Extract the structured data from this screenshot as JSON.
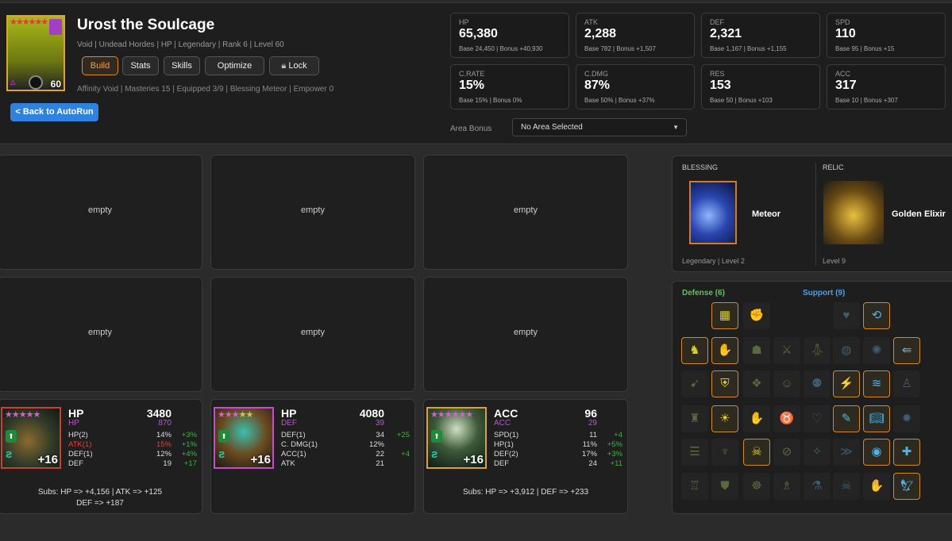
{
  "hero": {
    "name": "Urost the Soulcage",
    "meta": "Void | Undead Hordes | HP | Legendary | Rank 6 | Level 60",
    "meta2": "Affinity Void  |  Masteries 15  |  Equipped 3/9  |  Blessing Meteor  |  Empower 0",
    "level": "60",
    "stars": "★★★★★★"
  },
  "tabs": [
    "Build",
    "Stats",
    "Skills",
    "Optimize"
  ],
  "lock_label": "Lock",
  "back_label": "< Back to AutoRun",
  "stats": [
    {
      "label": "HP",
      "value": "65,380",
      "sub": "Base 24,450  |  Bonus +40,930"
    },
    {
      "label": "ATK",
      "value": "2,288",
      "sub": "Base 782  |  Bonus +1,507"
    },
    {
      "label": "DEF",
      "value": "2,321",
      "sub": "Base 1,167  |  Bonus +1,155"
    },
    {
      "label": "SPD",
      "value": "110",
      "sub": "Base 95  |  Bonus +15"
    },
    {
      "label": "C.RATE",
      "value": "15%",
      "sub": "Base 15%  |  Bonus 0%"
    },
    {
      "label": "C.DMG",
      "value": "87%",
      "sub": "Base 50%  |  Bonus +37%"
    },
    {
      "label": "RES",
      "value": "153",
      "sub": "Base 50  |  Bonus +103"
    },
    {
      "label": "ACC",
      "value": "317",
      "sub": "Base 10  |  Bonus +307"
    }
  ],
  "area": {
    "label": "Area Bonus",
    "value": "No Area Selected"
  },
  "empty_label": "empty",
  "gear": [
    {
      "main": "HP",
      "main_value": "3480",
      "main_name": "HP",
      "main_bonus": "870",
      "level": "+16",
      "rows": [
        {
          "n": "HP(2)",
          "v": "14%",
          "b": "+3%",
          "red": false
        },
        {
          "n": "ATK(1)",
          "v": "15%",
          "b": "+1%",
          "red": true
        },
        {
          "n": "DEF(1)",
          "v": "12%",
          "b": "+4%",
          "red": false
        },
        {
          "n": "DEF",
          "v": "19",
          "b": "+17",
          "red": false
        }
      ],
      "subs1": "Subs: HP => +4,156  |  ATK => +125",
      "subs2": "DEF => +187"
    },
    {
      "main": "HP",
      "main_value": "4080",
      "main_name": "DEF",
      "main_bonus": "39",
      "level": "+16",
      "rows": [
        {
          "n": "DEF(1)",
          "v": "34",
          "b": "+25",
          "red": false
        },
        {
          "n": "C. DMG(1)",
          "v": "12%",
          "b": "",
          "red": false
        },
        {
          "n": "ACC(1)",
          "v": "22",
          "b": "+4",
          "red": false
        },
        {
          "n": "ATK",
          "v": "21",
          "b": "",
          "red": false
        }
      ],
      "subs1": "",
      "subs2": ""
    },
    {
      "main": "ACC",
      "main_value": "96",
      "main_name": "ACC",
      "main_bonus": "29",
      "level": "+16",
      "rows": [
        {
          "n": "SPD(1)",
          "v": "11",
          "b": "+4",
          "red": false
        },
        {
          "n": "HP(1)",
          "v": "11%",
          "b": "+5%",
          "red": false
        },
        {
          "n": "DEF(2)",
          "v": "17%",
          "b": "+3%",
          "red": false
        },
        {
          "n": "DEF",
          "v": "24",
          "b": "+11",
          "red": false
        }
      ],
      "subs1": "Subs: HP => +3,912  |  DEF => +233",
      "subs2": ""
    }
  ],
  "blessing": {
    "header": "BLESSING",
    "name": "Meteor",
    "sub": "Legendary | Level 2"
  },
  "relic": {
    "header": "RELIC",
    "name": "Golden Elixir",
    "sub": "Level 9"
  },
  "mastery": {
    "defense_label": "Defense (6)",
    "support_label": "Support (9)",
    "defense_color": "#5cc35a",
    "support_color": "#4aa0f0"
  }
}
